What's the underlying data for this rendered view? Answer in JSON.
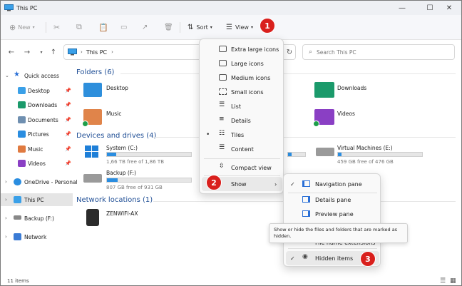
{
  "window": {
    "title": "This PC"
  },
  "cmdbar": {
    "new_label": "New",
    "sort_label": "Sort",
    "view_label": "View"
  },
  "address": {
    "path": "This PC",
    "search_placeholder": "Search This PC"
  },
  "sidebar": {
    "items": [
      {
        "label": "Quick access"
      },
      {
        "label": "Desktop"
      },
      {
        "label": "Downloads"
      },
      {
        "label": "Documents"
      },
      {
        "label": "Pictures"
      },
      {
        "label": "Music"
      },
      {
        "label": "Videos"
      },
      {
        "label": "OneDrive - Personal"
      },
      {
        "label": "This PC"
      },
      {
        "label": "Backup (F:)"
      },
      {
        "label": "Network"
      }
    ]
  },
  "content": {
    "folders_header": "Folders (6)",
    "folders": [
      "Desktop",
      "Downloads",
      "Music",
      "Videos"
    ],
    "drives_header": "Devices and drives (4)",
    "drives": [
      {
        "name": "System (C:)",
        "free": "1,66 TB free of 1,86 TB",
        "used_fraction": 0.11
      },
      {
        "name": "Virtual Machines (E:)",
        "free": "459 GB free of 476 GB",
        "used_fraction": 0.04
      },
      {
        "name": "Backup (F:)",
        "free": "807 GB free of 931 GB",
        "used_fraction": 0.13
      },
      {
        "name": "",
        "free": "",
        "used_fraction": 0.2
      }
    ],
    "network_header": "Network locations (1)",
    "network": [
      "ZENWIFI-AX"
    ]
  },
  "status": {
    "items": "11 items"
  },
  "view_menu": {
    "items": [
      {
        "label": "Extra large icons"
      },
      {
        "label": "Large icons"
      },
      {
        "label": "Medium icons"
      },
      {
        "label": "Small icons"
      },
      {
        "label": "List"
      },
      {
        "label": "Details"
      },
      {
        "label": "Tiles"
      },
      {
        "label": "Content"
      },
      {
        "label": "Compact view"
      },
      {
        "label": "Show"
      }
    ]
  },
  "show_menu": {
    "items": [
      {
        "label": "Navigation pane"
      },
      {
        "label": "Details pane"
      },
      {
        "label": "Preview pane"
      },
      {
        "label": "File name extensions"
      },
      {
        "label": "Hidden items"
      }
    ]
  },
  "tooltip": {
    "text": "Show or hide the files and folders that are marked as hidden."
  },
  "badges": [
    "1",
    "2",
    "3"
  ],
  "colors": {
    "accent": "#2a8de0",
    "badge": "#d9201d",
    "section": "#1f4e95"
  }
}
